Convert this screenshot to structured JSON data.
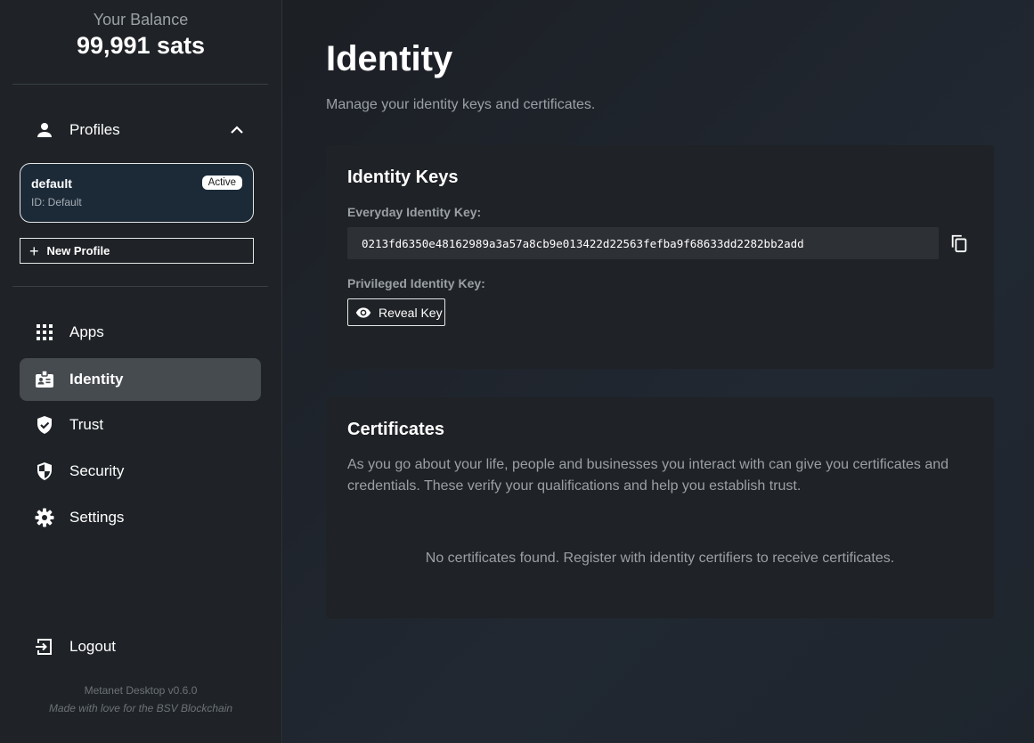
{
  "sidebar": {
    "balance_label": "Your Balance",
    "balance_value": "99,991 sats",
    "profiles_label": "Profiles",
    "profile": {
      "name": "default",
      "id": "ID: Default",
      "badge": "Active"
    },
    "new_profile_label": "New Profile",
    "nav": {
      "apps": "Apps",
      "identity": "Identity",
      "trust": "Trust",
      "security": "Security",
      "settings": "Settings"
    },
    "logout_label": "Logout",
    "version": "Metanet Desktop v0.6.0",
    "tagline": "Made with love for the BSV Blockchain"
  },
  "main": {
    "title": "Identity",
    "subtitle": "Manage your identity keys and certificates.",
    "keys": {
      "title": "Identity Keys",
      "everyday_label": "Everyday Identity Key:",
      "everyday_value": "0213fd6350e48162989a3a57a8cb9e013422d22563fefba9f68633dd2282bb2add",
      "privileged_label": "Privileged Identity Key:",
      "reveal_label": "Reveal Key"
    },
    "certificates": {
      "title": "Certificates",
      "description": "As you go about your life, people and businesses you interact with can give you certificates and credentials. These verify your qualifications and help you establish trust.",
      "empty": "No certificates found. Register with identity certifiers to receive certificates."
    }
  },
  "colors": {
    "sidebar_bg": "#1f2327",
    "active_nav_bg": "#464b50",
    "card_bg": "#1f2226",
    "profile_card_bg": "#1c2a38",
    "muted_text": "#9aa0a6"
  },
  "icons": {
    "profiles": "person-icon",
    "collapse": "chevron-up-icon",
    "apps": "grid-icon",
    "identity": "badge-icon",
    "trust": "shield-check-icon",
    "security": "shield-half-icon",
    "settings": "gear-icon",
    "logout": "logout-icon",
    "copy": "copy-icon",
    "reveal": "eye-icon"
  }
}
